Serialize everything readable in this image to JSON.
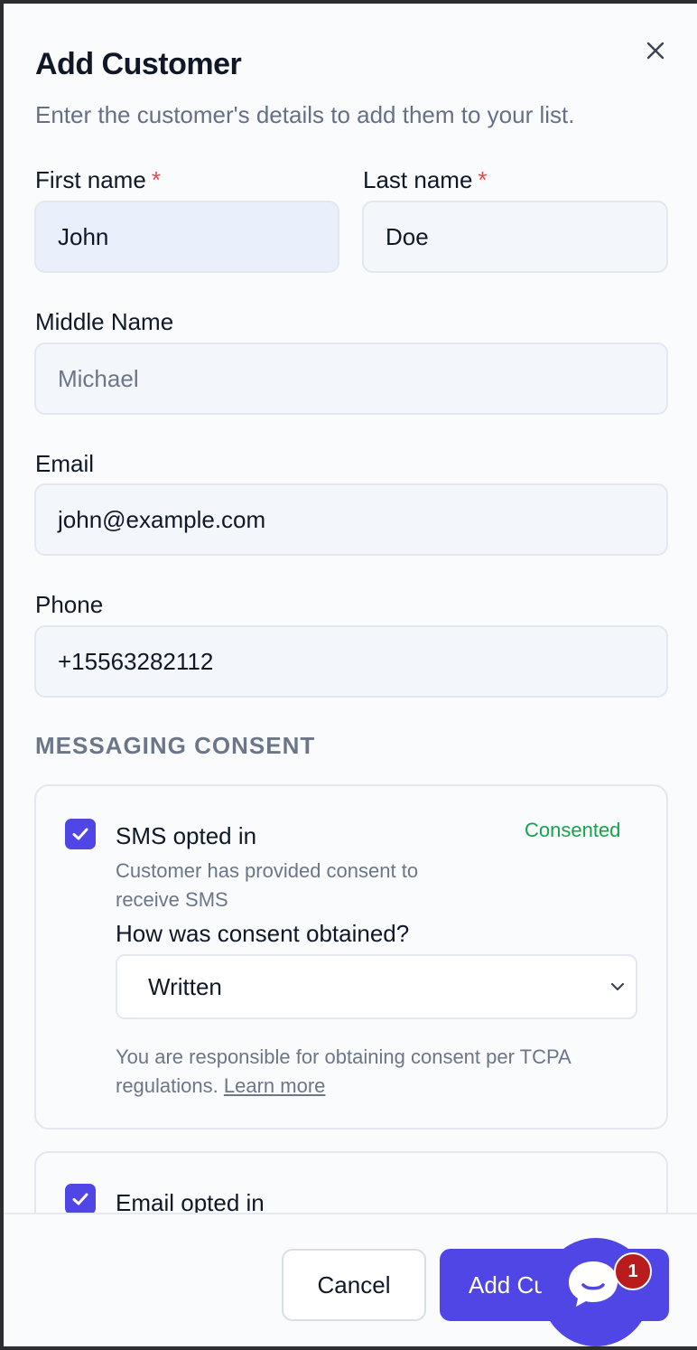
{
  "dialog": {
    "title": "Add Customer",
    "subtitle": "Enter the customer's details to add them to your list.",
    "close_icon": "close-icon"
  },
  "fields": {
    "first_name": {
      "label": "First name",
      "required_mark": "*",
      "value": "John"
    },
    "last_name": {
      "label": "Last name",
      "required_mark": "*",
      "value": "Doe"
    },
    "middle_name": {
      "label": "Middle Name",
      "placeholder": "Michael"
    },
    "email": {
      "label": "Email",
      "value": "john@example.com"
    },
    "phone": {
      "label": "Phone",
      "value": "+15563282112"
    }
  },
  "consent": {
    "section_title": "MESSAGING CONSENT",
    "sms": {
      "label": "SMS opted in",
      "checked": true,
      "status": "Consented",
      "description": "Customer has provided consent to receive SMS",
      "method_label": "How was consent obtained?",
      "method_value": "Written",
      "notice": "You are responsible for obtaining consent per TCPA regulations.",
      "learn_more": "Learn more"
    },
    "email": {
      "label": "Email opted in",
      "checked": true
    }
  },
  "footer": {
    "cancel_label": "Cancel",
    "submit_label": "Add Cu"
  },
  "chat_widget": {
    "icon": "chat-icon",
    "notification_count": "1"
  },
  "colors": {
    "accent": "#4f46e5",
    "consented": "#16a34a",
    "required": "#e5484d",
    "notification": "#b91c1c"
  }
}
